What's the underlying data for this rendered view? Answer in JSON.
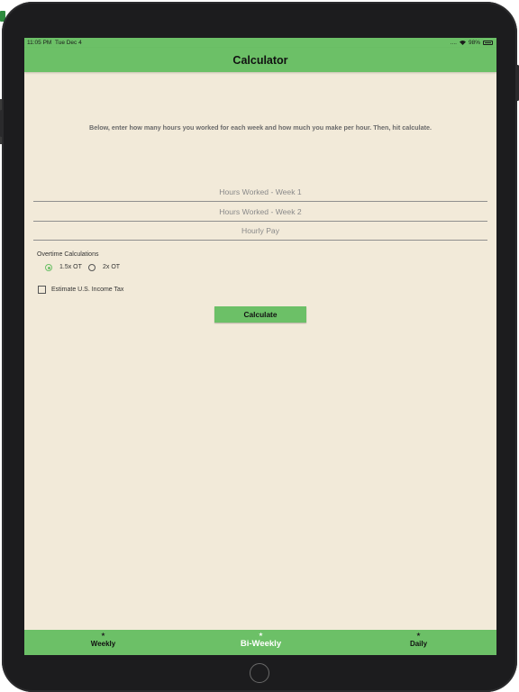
{
  "status_bar": {
    "time": "11:05 PM",
    "date": "Tue Dec 4",
    "signal": "....",
    "battery": "98%"
  },
  "nav": {
    "title": "Calculator"
  },
  "instructions": "Below, enter how many hours you worked for each week and how much you make per hour. Then, hit calculate.",
  "fields": {
    "week1_placeholder": "Hours Worked - Week 1",
    "week2_placeholder": "Hours Worked - Week 2",
    "pay_placeholder": "Hourly Pay"
  },
  "overtime": {
    "label": "Overtime Calculations",
    "options": [
      {
        "label": "1.5x OT",
        "selected": true
      },
      {
        "label": "2x OT",
        "selected": false
      }
    ]
  },
  "tax": {
    "label": "Estimate U.S. Income Tax",
    "checked": false
  },
  "calculate_label": "Calculate",
  "tabs": [
    {
      "label": "Weekly",
      "icon": "star-icon",
      "active": false
    },
    {
      "label": "Bi-Weekly",
      "icon": "star-icon",
      "active": true
    },
    {
      "label": "Daily",
      "icon": "star-icon",
      "active": false
    }
  ],
  "colors": {
    "accent": "#6cc067",
    "background": "#f2ead9",
    "device": "#1c1c1e"
  }
}
